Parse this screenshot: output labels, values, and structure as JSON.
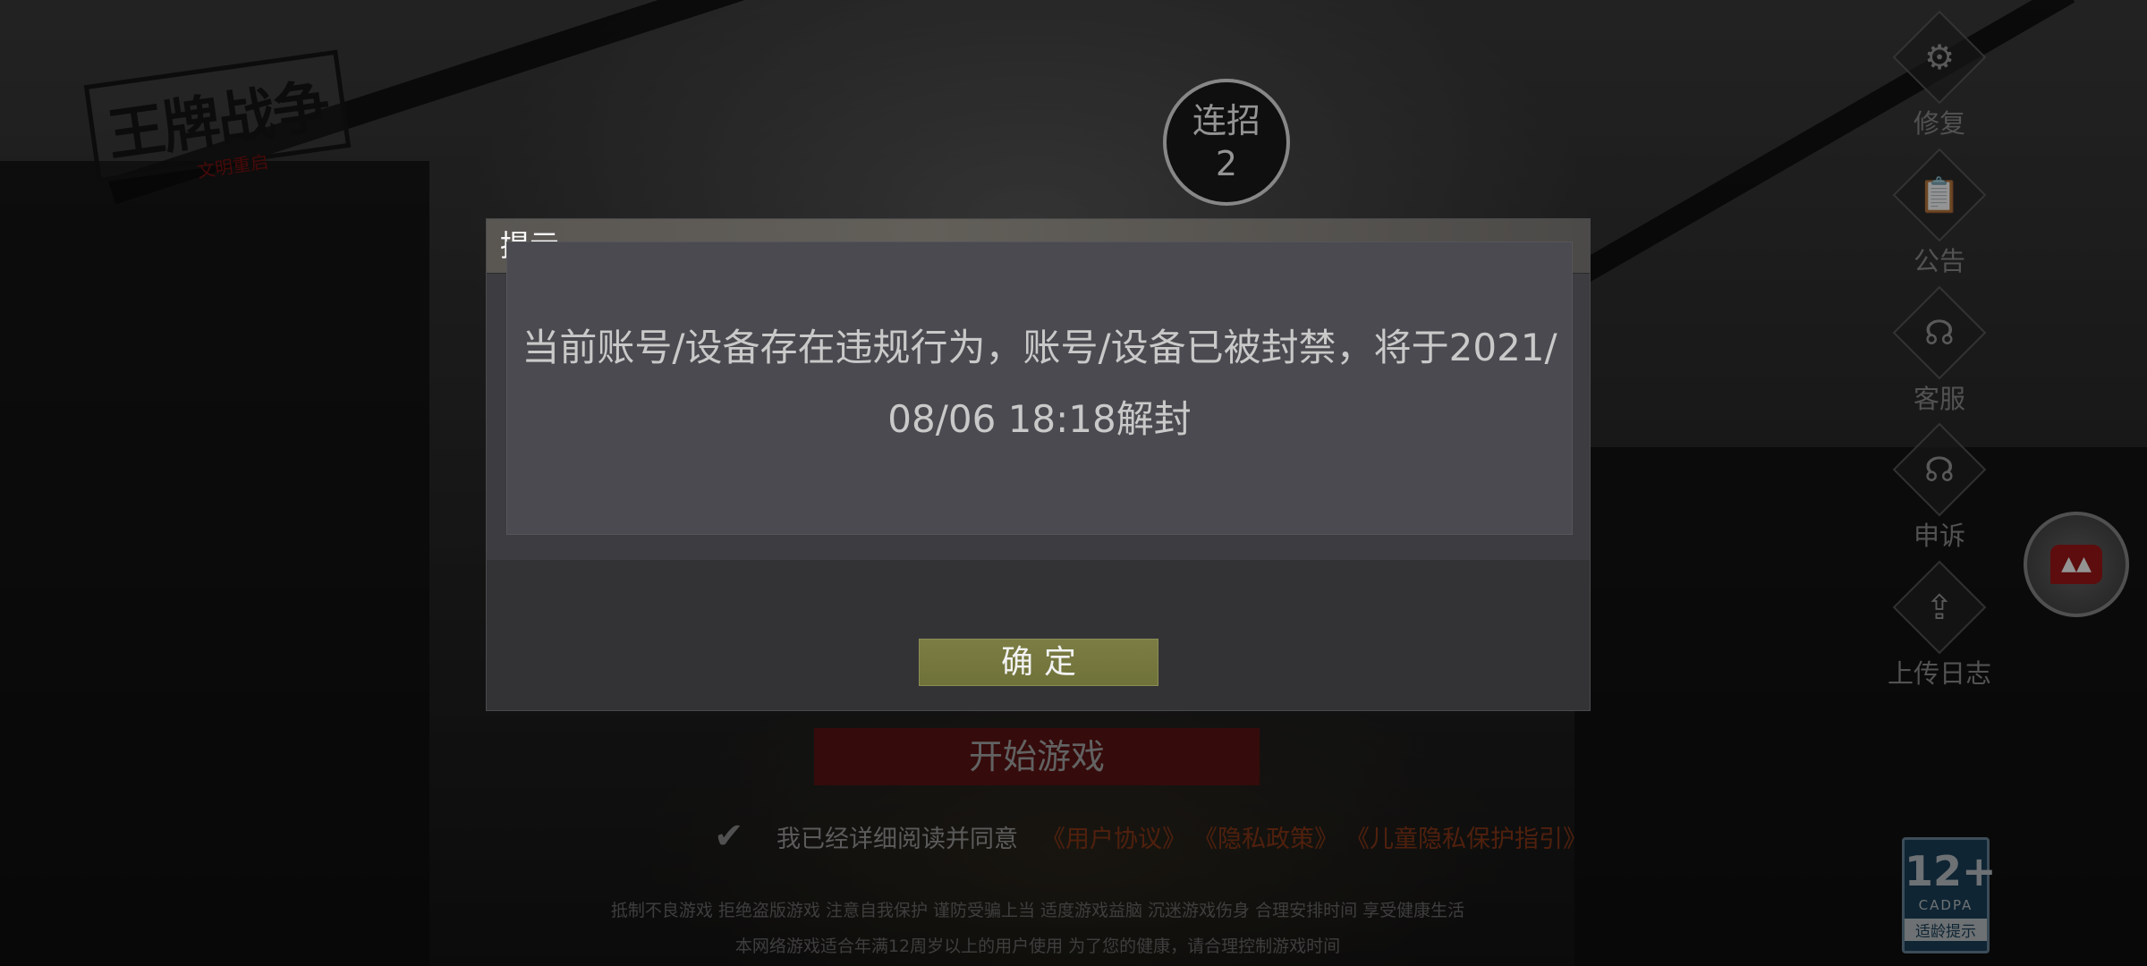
{
  "combo": {
    "label": "连招",
    "count": "2"
  },
  "logo": {
    "title": "王牌战争",
    "subtitle": "文明重启"
  },
  "sidebar": {
    "items": [
      {
        "label": "修复",
        "icon": "gears-icon"
      },
      {
        "label": "公告",
        "icon": "announcement-icon"
      },
      {
        "label": "客服",
        "icon": "headset-icon"
      },
      {
        "label": "申诉",
        "icon": "headset-icon"
      },
      {
        "label": "上传日志",
        "icon": "upload-icon"
      }
    ]
  },
  "start_button": "开始游戏",
  "agreement": {
    "text": "我已经详细阅读并同意",
    "links": [
      "《用户协议》",
      "《隐私政策》",
      "《儿童隐私保护指引》"
    ]
  },
  "notice": {
    "line1": "抵制不良游戏 拒绝盗版游戏 注意自我保护 谨防受骗上当 适度游戏益脑 沉迷游戏伤身 合理安排时间 享受健康生活",
    "line2": "本网络游戏适合年满12周岁以上的用户使用    为了您的健康，请合理控制游戏时间"
  },
  "age_badge": {
    "rating": "12+",
    "org": "CADPA",
    "tip": "适龄提示"
  },
  "dialog": {
    "title": "提示",
    "message": "当前账号/设备存在违规行为，账号/设备已被封禁，将于2021/08/06 18:18解封",
    "confirm": "确定"
  },
  "colors": {
    "confirm_button": "#767a3f",
    "start_button": "#5e1414",
    "agreement_link": "#8a3818",
    "age_badge": "#1e4e6e"
  }
}
